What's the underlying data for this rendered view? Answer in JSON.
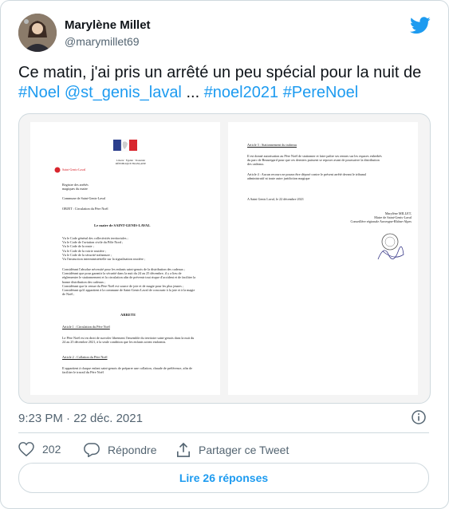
{
  "author": {
    "name": "Marylène Millet",
    "handle": "@marymillet69"
  },
  "tweet": {
    "intro": "Ce matin, j'ai pris un arrêté un peu spécial pour la nuit de",
    "tag_noel": "#Noel",
    "mention": "@st_genis_laval",
    "ellipsis": "...",
    "tag_noel2021": "#noel2021",
    "tag_perenoel": "#PereNoel"
  },
  "document": {
    "rf_header": "Liberté · Égalité · Fraternité\nRÉPUBLIQUE FRANÇAISE",
    "logo_text": "Saint-Genis-Laval",
    "registre": "Registre des arrêtés\nmagiques du maire",
    "commune": "Commune de Saint-Genis-Laval",
    "objet": "OBJET : Circulation du Père Noël",
    "maire_title": "Le maire de SAINT-GENIS-LAVAL",
    "vus": "Vu le Code général des collectivités territoriales ;\nVu le Code de l'aviation civile du Pôle Nord ;\nVu le Code de la route ;\nVu le Code de la voirie routière ;\nVu le Code de la sécurité traîneaure ;\nVu l'instruction interministérielle sur la signalisation routière ;",
    "considerants": "Considérant l'absolue nécessité pour les enfants saint-genois de la distribution des cadeaux ;\nConsidérant que pour garantir la sécurité dans la nuit du 24 au 25 décembre, il y a lieu de réglementer le stationnement et la circulation afin de prévenir tout risque d'accident et de faciliter la bonne distribution des cadeaux ;\nConsidérant que la venue du Père Noël est source de joie et de magie pour les plus jeunes ;\nConsidérant qu'il appartient à la commune de Saint-Genis-Laval de concourir à la joie et à la magie de Noël ;",
    "arrete": "ARRETE",
    "article1_title": "Article 1 : Circulation du Père Noël",
    "article1_text": "Le Père Noël est en droit de survoler librement l'ensemble du territoire saint-genois dans la nuit du 24 au 25 décembre 2021, à la seule condition que les enfants soient endormis.",
    "article2_title": "Article 2 : Collation du Père Noël",
    "article2_text": "Il appartient à chaque enfant saint-genois de préparer une collation, chaude de préférence, afin de faciliter le travail du Père Noël",
    "article3_title": "Article 3 : Stationnement du traîneau",
    "article3_text": "Il est donné autorisation au Père Noël de stationner et faire paître ses rennes sur les espaces enherbés du parc de Beauregard pour que ces derniers puissent se reposer avant de poursuivre la distribution des cadeaux.",
    "article4_text": "Article 4 : Aucun recours ne pourra être déposé contre le présent arrêté devant le tribunal administratif ni toute autre juridiction magique",
    "fait": "A Saint Genis Laval, le 22 décembre 2021",
    "signature": "Marylène MILLET,\nMaire de Saint-Genis-Laval\nConseillère régionale Auvergne-Rhône-Alpes"
  },
  "timestamp": "9:23 PM · 22 déc. 2021",
  "actions": {
    "likes": "202",
    "reply": "Répondre",
    "share": "Partager ce Tweet"
  },
  "read_replies": "Lire 26 réponses",
  "colors": {
    "link": "#1d9bf0",
    "muted": "#536471",
    "border": "#cfd9de",
    "like_red": "#f91880"
  }
}
